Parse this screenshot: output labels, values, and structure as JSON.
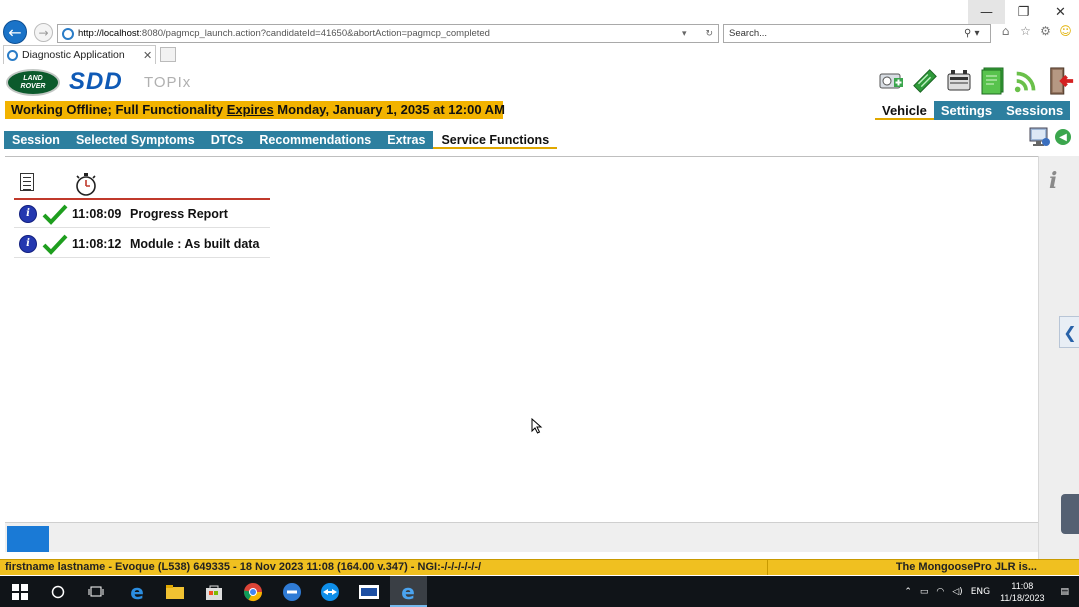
{
  "browser": {
    "url_host": "http://localhost",
    "url_rest": ":8080/pagmcp_launch.action?candidateId=41650&abortAction=pagmcp_completed",
    "search_placeholder": "Search...",
    "tab_title": "Diagnostic Application",
    "window_controls": {
      "minimize": "—",
      "restore": "❐",
      "close": "✕"
    }
  },
  "app": {
    "logo_line1": "LAND",
    "logo_line2": "ROVER",
    "product": "SDD",
    "subtitle": "TOPIx",
    "banner_prefix": "Working Offline; Full Functionality ",
    "banner_expires": "Expires",
    "banner_suffix": " Monday, January 1, 2035 at 12:00 AM",
    "top_nav": [
      "Vehicle",
      "Settings",
      "Sessions"
    ],
    "top_nav_active": "Vehicle",
    "session_tabs": [
      "Session",
      "Selected Symptoms",
      "DTCs",
      "Recommendations",
      "Extras",
      "Service Functions"
    ],
    "session_tab_active": "Service Functions"
  },
  "log": {
    "rows": [
      {
        "time": "11:08:09",
        "message": "Progress Report"
      },
      {
        "time": "11:08:12",
        "message": "Module : As built data"
      }
    ]
  },
  "status": {
    "left": "firstname lastname - Evoque (L538) 649335 - 18 Nov 2023 11:08 (164.00 v.347) - NGI:-/-/-/-/-/-/",
    "right": "The MongoosePro JLR is..."
  },
  "taskbar": {
    "lang": "ENG",
    "time": "11:08",
    "date": "11/18/2023"
  },
  "colors": {
    "accent_teal": "#2d7f9f",
    "banner_yellow": "#f2b300",
    "status_yellow": "#f0c020",
    "brand_blue": "#0f5ab6"
  }
}
